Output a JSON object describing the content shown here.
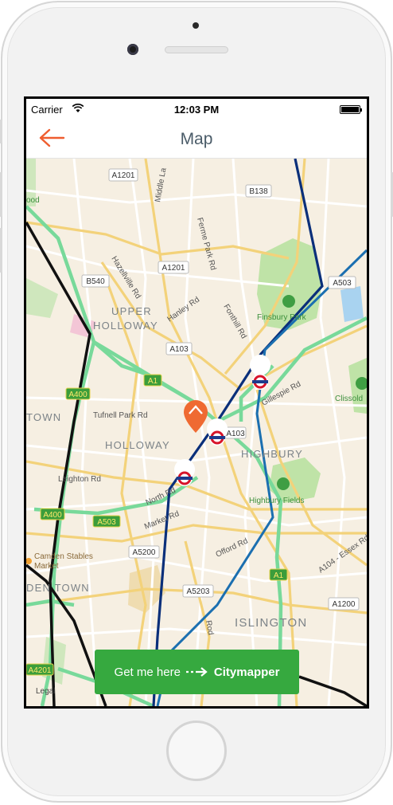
{
  "status_bar": {
    "carrier": "Carrier",
    "time": "12:03 PM"
  },
  "nav": {
    "title": "Map",
    "back_icon": "arrow-left-icon",
    "accent": "#ef5d2f"
  },
  "map": {
    "road_labels": [
      "A1201",
      "B138",
      "Ferme Park Rd",
      "Middle La",
      "A1201",
      "B540",
      "Hazellville Rd",
      "Hanley Rd",
      "Fonthill Rd",
      "A103",
      "A503",
      "A1",
      "A400",
      "Tufnell Park Rd",
      "Gillespie Rd",
      "A103",
      "Leighton Rd",
      "North Rd",
      "Market Rd",
      "A400",
      "A503",
      "A5200",
      "Offord Rd",
      "A5203",
      "A104 - Essex Rd",
      "A1",
      "A1200",
      "A4201",
      "Rod"
    ],
    "area_labels": [
      "UPPER",
      "HOLLOWAY",
      "HOLLOWAY",
      "TOWN",
      "HIGHBURY",
      "DEN TOWN",
      "ISLINGTON"
    ],
    "park_labels": [
      "Finsbury Park",
      "Highbury Fields",
      "Clissold"
    ],
    "place_labels": [
      "Camden Stables",
      "Market",
      "ood"
    ],
    "legal": "Legal",
    "markers": [
      "destination-pin",
      "underground-station",
      "underground-station",
      "underground-station"
    ]
  },
  "cta": {
    "label": "Get me here",
    "brand": "Citymapper",
    "arrow_icon": "dashed-arrow-icon",
    "color": "#36a93f"
  }
}
